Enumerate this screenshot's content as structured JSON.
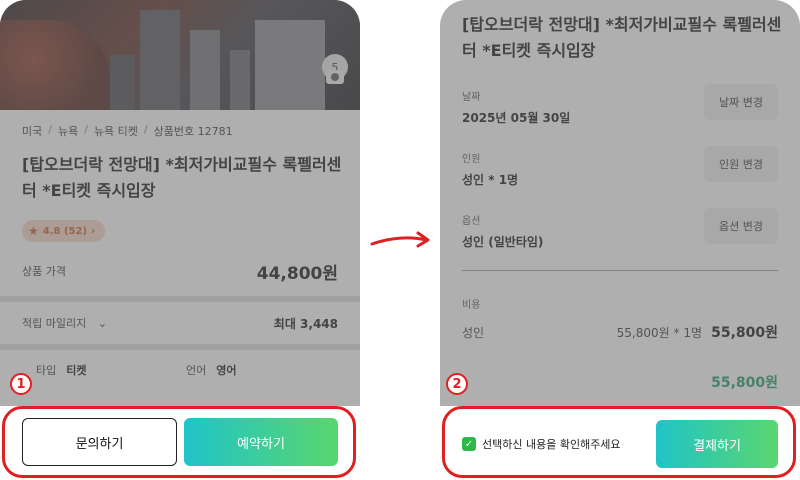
{
  "left": {
    "photo_count": "5",
    "breadcrumb": [
      "미국",
      "뉴욕",
      "뉴욕 티켓",
      "상품번호 12781"
    ],
    "breadcrumb_sep": "/",
    "title": "[탑오브더락 전망대] *최저가비교필수 록펠러센터 *E티켓 즉시입장",
    "rating": "4.8 (52)",
    "rating_chevron": "›",
    "price_label": "상품 가격",
    "price_value": "44,800원",
    "mileage_label": "적립 마일리지",
    "mileage_chevron": "⌄",
    "mileage_value": "최대 3,448",
    "type_label": "타입",
    "type_value": "티켓",
    "lang_label": "언어",
    "lang_value": "영어",
    "inquiry_button": "문의하기",
    "reserve_button": "예약하기"
  },
  "right": {
    "title": "[탑오브더락 전망대] *최저가비교필수 록펠러센터 *E티켓 즉시입장",
    "date_label": "날짜",
    "date_value": "2025년 05월 30일",
    "date_button": "날짜 변경",
    "people_label": "인원",
    "people_value": "성인 * 1명",
    "people_button": "인원 변경",
    "option_label": "옵션",
    "option_value": "성인 (일반타임)",
    "option_button": "옵션 변경",
    "cost_label": "비용",
    "cost_name": "성인",
    "cost_calc": "55,800원 * 1명",
    "cost_sum": "55,800원",
    "total": "55,800원",
    "confirm_text": "선택하신 내용을 확인해주세요",
    "pay_button": "결제하기"
  },
  "annotations": {
    "step1": "1",
    "step2": "2",
    "color": "#e02020"
  },
  "colors": {
    "accent_start": "#20c4c8",
    "accent_end": "#5ad66e",
    "total_green": "#1d9a63"
  }
}
